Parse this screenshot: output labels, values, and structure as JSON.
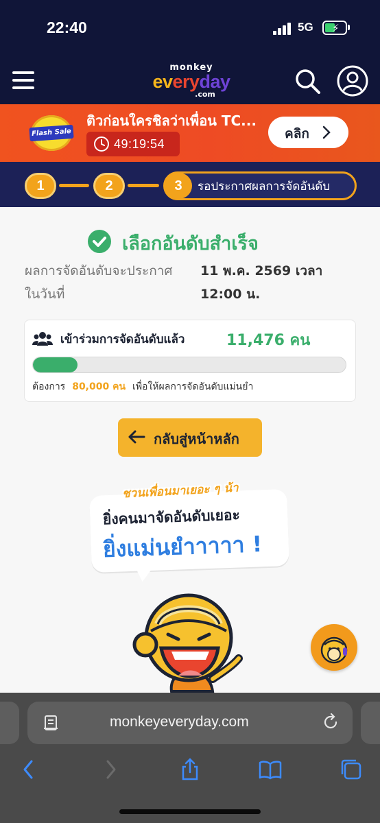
{
  "status_bar": {
    "time": "22:40",
    "network": "5G"
  },
  "header": {
    "logo_line1": "monkey",
    "logo_line2a": "ev",
    "logo_line2b": "ery",
    "logo_line2c": "day",
    "logo_line3": ".com"
  },
  "flash_banner": {
    "badge": "Flash Sale",
    "title": "ติวก่อนใครชิลว่าเพื่อน TC...",
    "countdown": "49:19:54",
    "button_label": "คลิก"
  },
  "stepper": {
    "steps": [
      {
        "number": "1"
      },
      {
        "number": "2"
      },
      {
        "number": "3",
        "label": "รอประกาศผลการจัดอันดับ"
      }
    ]
  },
  "result": {
    "title": "เลือกอันดับสำเร็จ",
    "announce_label_line1": "ผลการจัดอันดับจะประกาศ",
    "announce_label_line2": "ในวันที่",
    "announce_value_line1": "11 พ.ค. 2569 เวลา",
    "announce_value_line2": "12:00 น."
  },
  "participation": {
    "label": "เข้าร่วมการจัดอันดับแล้ว",
    "count": "11,476 คน",
    "progress_fraction": 0.1435,
    "target_prefix": "ต้องการ",
    "target_value": "80,000 คน",
    "target_suffix": "เพื่อให้ผลการจัดอันดับแม่นยำ"
  },
  "home_button": {
    "label": "กลับสู่หน้าหลัก"
  },
  "promo": {
    "top": "ชวนเพื่อนมาเยอะ ๆ น้า",
    "middle": "ยิ่งคนมาจัดอันดับเยอะ",
    "big": "ยิ่งแม่นยำาาาา !"
  },
  "browser": {
    "url": "monkeyeveryday.com"
  },
  "colors": {
    "header_bg": "#101538",
    "banner_orange": "#f0531f",
    "stepper_bg": "#1c2157",
    "accent_orange": "#f2a31c",
    "success_green": "#3aae6b",
    "promo_blue": "#2f7ee0",
    "chrome_gray": "#4a4a4a"
  },
  "icons": [
    "hamburger-icon",
    "search-icon",
    "user-icon",
    "clock-icon",
    "chevron-right-icon",
    "check-icon",
    "people-icon",
    "arrow-left-icon",
    "reader-icon",
    "reload-icon",
    "back-icon",
    "forward-icon",
    "share-icon",
    "bookmarks-icon",
    "tabs-icon"
  ]
}
